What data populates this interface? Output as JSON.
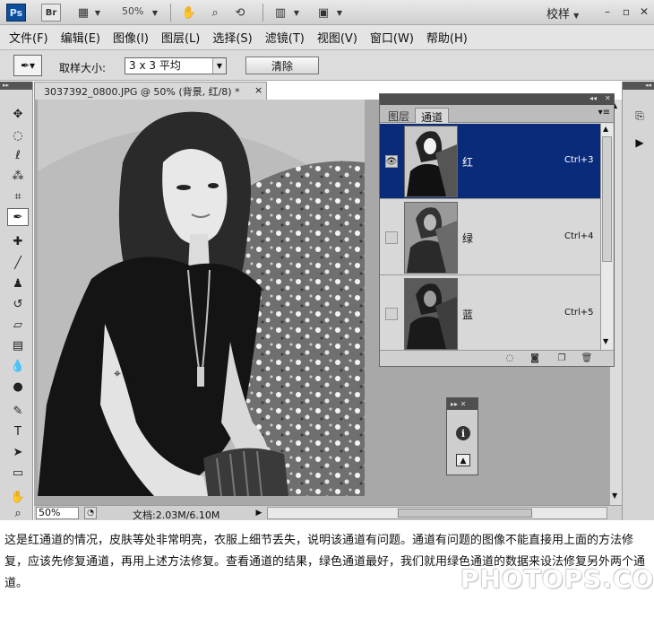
{
  "app": {
    "logo": "Ps",
    "bridge": "Br",
    "zoom": "50%",
    "workspace": "校样"
  },
  "menu": [
    "文件(F)",
    "编辑(E)",
    "图像(I)",
    "图层(L)",
    "选择(S)",
    "滤镜(T)",
    "视图(V)",
    "窗口(W)",
    "帮助(H)"
  ],
  "options": {
    "sample_label": "取样大小:",
    "sample_value": "3 x 3 平均",
    "clear_button": "清除"
  },
  "document": {
    "tab_title": "3037392_0800.JPG @ 50% (背景, 红/8) *",
    "close": "×",
    "status_zoom": "50%",
    "status_doc": "文档:2.03M/6.10M",
    "sampler_label": "1"
  },
  "panel": {
    "tabs": [
      "图层",
      "通道"
    ],
    "active_tab": "通道",
    "channels": [
      {
        "name": "红",
        "shortcut": "Ctrl+3",
        "selected": true,
        "visible": true
      },
      {
        "name": "绿",
        "shortcut": "Ctrl+4",
        "selected": false,
        "visible": false
      },
      {
        "name": "蓝",
        "shortcut": "Ctrl+5",
        "selected": false,
        "visible": false
      }
    ]
  },
  "caption": {
    "text": "这是红通道的情况，皮肤等处非常明亮，衣服上细节丢失，说明该通道有问题。通道有问题的图像不能直接用上面的方法修复，应该先修复通道，再用上述方法修复。查看通道的结果，绿色通道最好，我们就用绿色通道的数据来设法修复另外两个通道。",
    "watermark": "PHOTOPS.COM"
  },
  "colors": {
    "selected_row": "#0a2a7a",
    "ps_blue": "#0d4f9a"
  }
}
